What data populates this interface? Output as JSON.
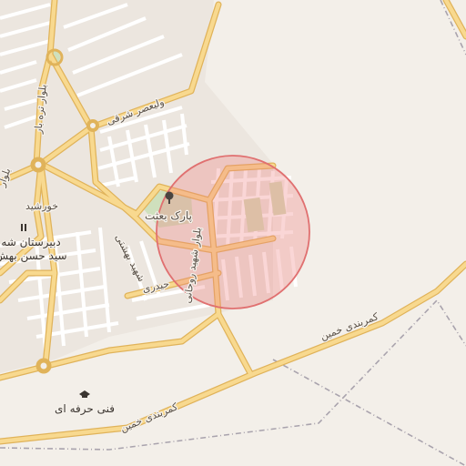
{
  "map": {
    "highlight_color": "#f08080",
    "road_color": "#f6d484",
    "road_casing": "#e6b85c",
    "labels": {
      "park": "پارک بعثت",
      "valiasr_east": "ولیعصر شرقی",
      "boulevard_tareh_bar": "بلوار تره بار",
      "khorshid": "خورشید",
      "school": "دبیرستان شه",
      "school_name": "سید حسن بهش",
      "shahid_rohani": "بلوار شهید روحانی",
      "heydari": "حیدری",
      "shahid_beheshti": "شهید بهشتی",
      "ring_road_1": "کمربندی خمین",
      "ring_road_2": "کمربندی خمین",
      "vocational": "فنی حرفه ای",
      "boulevard_left": "بلوار"
    },
    "icons": {
      "park": "tree-icon",
      "school": "school-icon",
      "vocational": "graduation-cap-icon"
    }
  }
}
